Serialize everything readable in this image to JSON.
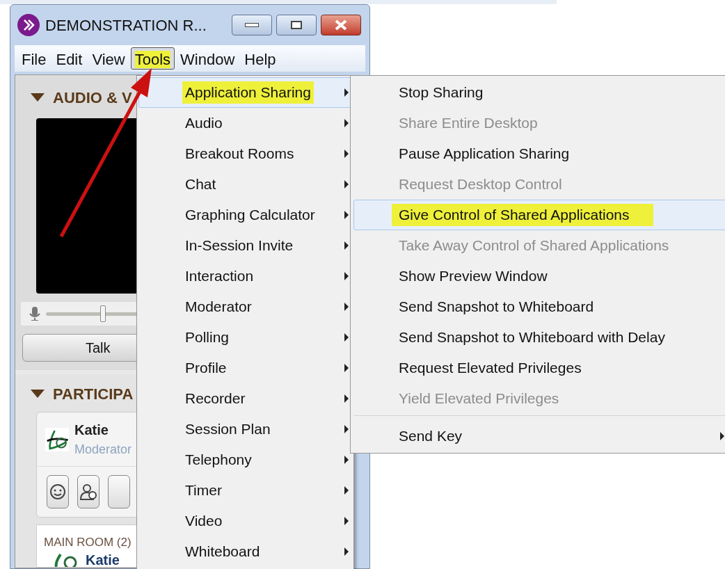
{
  "window": {
    "title": "DEMONSTRATION R..."
  },
  "menubar": [
    {
      "label": "File",
      "selected": false,
      "annotated": false
    },
    {
      "label": "Edit",
      "selected": false,
      "annotated": false
    },
    {
      "label": "View",
      "selected": false,
      "annotated": false
    },
    {
      "label": "Tools",
      "selected": true,
      "annotated": true
    },
    {
      "label": "Window",
      "selected": false,
      "annotated": false
    },
    {
      "label": "Help",
      "selected": false,
      "annotated": false
    }
  ],
  "audio_video": {
    "title": "AUDIO & V",
    "expanded": true,
    "level": 0.6,
    "talk_button": "Talk"
  },
  "participants": {
    "title": "PARTICIPA",
    "expanded": true,
    "me": {
      "name": "Katie",
      "role": "Moderator"
    },
    "room": "MAIN ROOM (2)",
    "first_member": "Katie"
  },
  "tools_menu": [
    {
      "label": "Application Sharing",
      "selected": true,
      "annotated": true,
      "submenu": true
    },
    {
      "label": "Audio",
      "selected": false,
      "annotated": false,
      "submenu": true
    },
    {
      "label": "Breakout Rooms",
      "selected": false,
      "annotated": false,
      "submenu": true
    },
    {
      "label": "Chat",
      "selected": false,
      "annotated": false,
      "submenu": true
    },
    {
      "label": "Graphing Calculator",
      "selected": false,
      "annotated": false,
      "submenu": true
    },
    {
      "label": "In-Session Invite",
      "selected": false,
      "annotated": false,
      "submenu": true
    },
    {
      "label": "Interaction",
      "selected": false,
      "annotated": false,
      "submenu": true
    },
    {
      "label": "Moderator",
      "selected": false,
      "annotated": false,
      "submenu": true
    },
    {
      "label": "Polling",
      "selected": false,
      "annotated": false,
      "submenu": true
    },
    {
      "label": "Profile",
      "selected": false,
      "annotated": false,
      "submenu": true
    },
    {
      "label": "Recorder",
      "selected": false,
      "annotated": false,
      "submenu": true
    },
    {
      "label": "Session Plan",
      "selected": false,
      "annotated": false,
      "submenu": true
    },
    {
      "label": "Telephony",
      "selected": false,
      "annotated": false,
      "submenu": true
    },
    {
      "label": "Timer",
      "selected": false,
      "annotated": false,
      "submenu": true
    },
    {
      "label": "Video",
      "selected": false,
      "annotated": false,
      "submenu": true
    },
    {
      "label": "Whiteboard",
      "selected": false,
      "annotated": false,
      "submenu": true
    }
  ],
  "sharing_menu": [
    {
      "kind": "item",
      "label": "Stop Sharing",
      "disabled": false,
      "selected": false,
      "annotated": false
    },
    {
      "kind": "item",
      "label": "Share Entire Desktop",
      "disabled": true,
      "selected": false,
      "annotated": false
    },
    {
      "kind": "item",
      "label": "Pause Application Sharing",
      "disabled": false,
      "selected": false,
      "annotated": false
    },
    {
      "kind": "item",
      "label": "Request Desktop Control",
      "disabled": true,
      "selected": false,
      "annotated": false
    },
    {
      "kind": "item",
      "label": "Give Control of Shared Applications",
      "disabled": false,
      "selected": true,
      "annotated": true
    },
    {
      "kind": "item",
      "label": "Take Away Control of Shared Applications",
      "disabled": true,
      "selected": false,
      "annotated": false
    },
    {
      "kind": "item",
      "label": "Show Preview Window",
      "disabled": false,
      "selected": false,
      "annotated": false
    },
    {
      "kind": "item",
      "label": "Send Snapshot to Whiteboard",
      "disabled": false,
      "selected": false,
      "annotated": false
    },
    {
      "kind": "item",
      "label": "Send Snapshot to Whiteboard with Delay",
      "disabled": false,
      "selected": false,
      "annotated": false
    },
    {
      "kind": "item",
      "label": "Request Elevated Privileges",
      "disabled": false,
      "selected": false,
      "annotated": false
    },
    {
      "kind": "item",
      "label": "Yield Elevated Privileges",
      "disabled": true,
      "selected": false,
      "annotated": false
    },
    {
      "kind": "separator"
    },
    {
      "kind": "submenu",
      "label": "Send Key",
      "disabled": false,
      "selected": false,
      "annotated": false
    }
  ]
}
